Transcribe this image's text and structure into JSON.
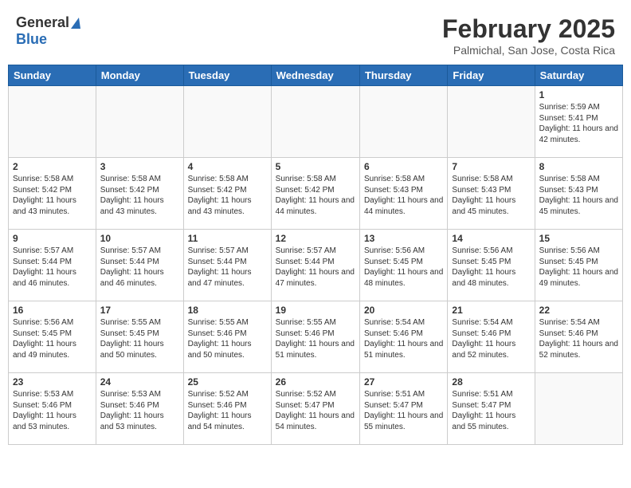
{
  "header": {
    "logo_general": "General",
    "logo_blue": "Blue",
    "month_title": "February 2025",
    "location": "Palmichal, San Jose, Costa Rica"
  },
  "days_of_week": [
    "Sunday",
    "Monday",
    "Tuesday",
    "Wednesday",
    "Thursday",
    "Friday",
    "Saturday"
  ],
  "weeks": [
    [
      {
        "day": "",
        "info": ""
      },
      {
        "day": "",
        "info": ""
      },
      {
        "day": "",
        "info": ""
      },
      {
        "day": "",
        "info": ""
      },
      {
        "day": "",
        "info": ""
      },
      {
        "day": "",
        "info": ""
      },
      {
        "day": "1",
        "info": "Sunrise: 5:59 AM\nSunset: 5:41 PM\nDaylight: 11 hours and 42 minutes."
      }
    ],
    [
      {
        "day": "2",
        "info": "Sunrise: 5:58 AM\nSunset: 5:42 PM\nDaylight: 11 hours and 43 minutes."
      },
      {
        "day": "3",
        "info": "Sunrise: 5:58 AM\nSunset: 5:42 PM\nDaylight: 11 hours and 43 minutes."
      },
      {
        "day": "4",
        "info": "Sunrise: 5:58 AM\nSunset: 5:42 PM\nDaylight: 11 hours and 43 minutes."
      },
      {
        "day": "5",
        "info": "Sunrise: 5:58 AM\nSunset: 5:42 PM\nDaylight: 11 hours and 44 minutes."
      },
      {
        "day": "6",
        "info": "Sunrise: 5:58 AM\nSunset: 5:43 PM\nDaylight: 11 hours and 44 minutes."
      },
      {
        "day": "7",
        "info": "Sunrise: 5:58 AM\nSunset: 5:43 PM\nDaylight: 11 hours and 45 minutes."
      },
      {
        "day": "8",
        "info": "Sunrise: 5:58 AM\nSunset: 5:43 PM\nDaylight: 11 hours and 45 minutes."
      }
    ],
    [
      {
        "day": "9",
        "info": "Sunrise: 5:57 AM\nSunset: 5:44 PM\nDaylight: 11 hours and 46 minutes."
      },
      {
        "day": "10",
        "info": "Sunrise: 5:57 AM\nSunset: 5:44 PM\nDaylight: 11 hours and 46 minutes."
      },
      {
        "day": "11",
        "info": "Sunrise: 5:57 AM\nSunset: 5:44 PM\nDaylight: 11 hours and 47 minutes."
      },
      {
        "day": "12",
        "info": "Sunrise: 5:57 AM\nSunset: 5:44 PM\nDaylight: 11 hours and 47 minutes."
      },
      {
        "day": "13",
        "info": "Sunrise: 5:56 AM\nSunset: 5:45 PM\nDaylight: 11 hours and 48 minutes."
      },
      {
        "day": "14",
        "info": "Sunrise: 5:56 AM\nSunset: 5:45 PM\nDaylight: 11 hours and 48 minutes."
      },
      {
        "day": "15",
        "info": "Sunrise: 5:56 AM\nSunset: 5:45 PM\nDaylight: 11 hours and 49 minutes."
      }
    ],
    [
      {
        "day": "16",
        "info": "Sunrise: 5:56 AM\nSunset: 5:45 PM\nDaylight: 11 hours and 49 minutes."
      },
      {
        "day": "17",
        "info": "Sunrise: 5:55 AM\nSunset: 5:45 PM\nDaylight: 11 hours and 50 minutes."
      },
      {
        "day": "18",
        "info": "Sunrise: 5:55 AM\nSunset: 5:46 PM\nDaylight: 11 hours and 50 minutes."
      },
      {
        "day": "19",
        "info": "Sunrise: 5:55 AM\nSunset: 5:46 PM\nDaylight: 11 hours and 51 minutes."
      },
      {
        "day": "20",
        "info": "Sunrise: 5:54 AM\nSunset: 5:46 PM\nDaylight: 11 hours and 51 minutes."
      },
      {
        "day": "21",
        "info": "Sunrise: 5:54 AM\nSunset: 5:46 PM\nDaylight: 11 hours and 52 minutes."
      },
      {
        "day": "22",
        "info": "Sunrise: 5:54 AM\nSunset: 5:46 PM\nDaylight: 11 hours and 52 minutes."
      }
    ],
    [
      {
        "day": "23",
        "info": "Sunrise: 5:53 AM\nSunset: 5:46 PM\nDaylight: 11 hours and 53 minutes."
      },
      {
        "day": "24",
        "info": "Sunrise: 5:53 AM\nSunset: 5:46 PM\nDaylight: 11 hours and 53 minutes."
      },
      {
        "day": "25",
        "info": "Sunrise: 5:52 AM\nSunset: 5:46 PM\nDaylight: 11 hours and 54 minutes."
      },
      {
        "day": "26",
        "info": "Sunrise: 5:52 AM\nSunset: 5:47 PM\nDaylight: 11 hours and 54 minutes."
      },
      {
        "day": "27",
        "info": "Sunrise: 5:51 AM\nSunset: 5:47 PM\nDaylight: 11 hours and 55 minutes."
      },
      {
        "day": "28",
        "info": "Sunrise: 5:51 AM\nSunset: 5:47 PM\nDaylight: 11 hours and 55 minutes."
      },
      {
        "day": "",
        "info": ""
      }
    ]
  ]
}
